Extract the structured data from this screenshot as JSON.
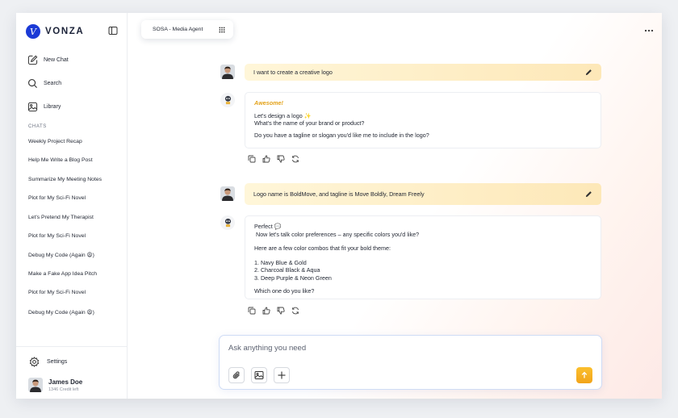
{
  "brand": {
    "name": "VONZA",
    "mark": "V"
  },
  "sidebar": {
    "nav": [
      {
        "label": "New Chat",
        "icon": "new-chat-icon"
      },
      {
        "label": "Search",
        "icon": "search-icon"
      },
      {
        "label": "Library",
        "icon": "library-icon"
      }
    ],
    "chats_title": "CHATS",
    "chats": [
      "Weekly Project Recap",
      "Help Me Write a Blog Post",
      "Summarize My Meeting Notes",
      "Plot for My Sci-Fi Novel",
      "Let's Pretend My Therapist",
      "Plot for My Sci-Fi Novel",
      "Debug My Code (Again 😩)",
      "Make a Fake App Idea Pitch",
      "Plot for My Sci-Fi Novel",
      "Debug My Code (Again 😩)"
    ],
    "settings_label": "Settings",
    "user": {
      "name": "James Doe",
      "credits": "1346 Credit left"
    }
  },
  "header": {
    "agent_label": "SOSA - Media Agent"
  },
  "conversation": {
    "user_message_1": "I want to create a creative logo",
    "bot_reply_1": {
      "heading": "Awesome!",
      "line1": "Let's design a logo ✨",
      "line2": "What's the name of your brand or product?",
      "line3": "Do you have a tagline or slogan you'd like me to include in the logo?"
    },
    "user_message_2": "Logo name is BoldMove, and tagline is Move Boldly, Dream Freely",
    "bot_reply_2": {
      "line1": "Perfect 💬",
      "line2": " Now let's talk color preferences – any specific colors you'd like?",
      "line3": "Here are a few color combos that fit your bold theme:",
      "options": [
        "1. Navy Blue & Gold",
        "2. Charcoal Black & Aqua",
        "3. Deep Purple & Neon Green"
      ],
      "question": "Which one do you like?"
    }
  },
  "composer": {
    "placeholder": "Ask anything you need"
  },
  "colors": {
    "accent": "#f2a41a",
    "brand": "#1b3ad6",
    "user_bubble": "#fde8b8"
  }
}
